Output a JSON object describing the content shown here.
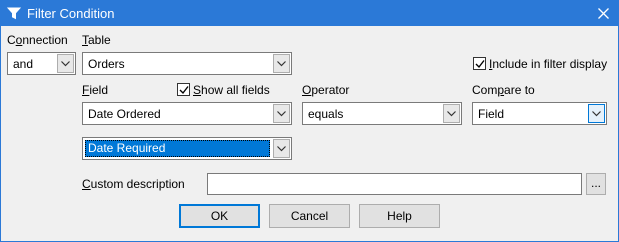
{
  "window": {
    "title": "Filter Condition"
  },
  "labels": {
    "connection": "Connection",
    "table": "Table",
    "field": "Field",
    "operator": "Operator",
    "compare_to": "Compare to",
    "custom_description": "Custom description"
  },
  "connection": {
    "value": "and"
  },
  "table": {
    "value": "Orders"
  },
  "include_in_filter_display": {
    "label": "Include in filter display",
    "checked": true
  },
  "show_all_fields": {
    "label": "Show all fields",
    "checked": true
  },
  "field": {
    "value": "Date Ordered"
  },
  "operator": {
    "value": "equals"
  },
  "compare_to": {
    "value": "Field"
  },
  "compare_field": {
    "value": "Date Required"
  },
  "custom_description": {
    "value": "",
    "browse_label": "..."
  },
  "buttons": {
    "ok": "OK",
    "cancel": "Cancel",
    "help": "Help"
  },
  "colors": {
    "title_bar": "#2b79d7",
    "selection": "#0078d7",
    "background": "#f0f0f0"
  },
  "icons": {
    "title": "funnel-icon",
    "close": "close-icon",
    "dropdown": "chevron-down-icon",
    "checkbox": "checkmark-icon"
  }
}
